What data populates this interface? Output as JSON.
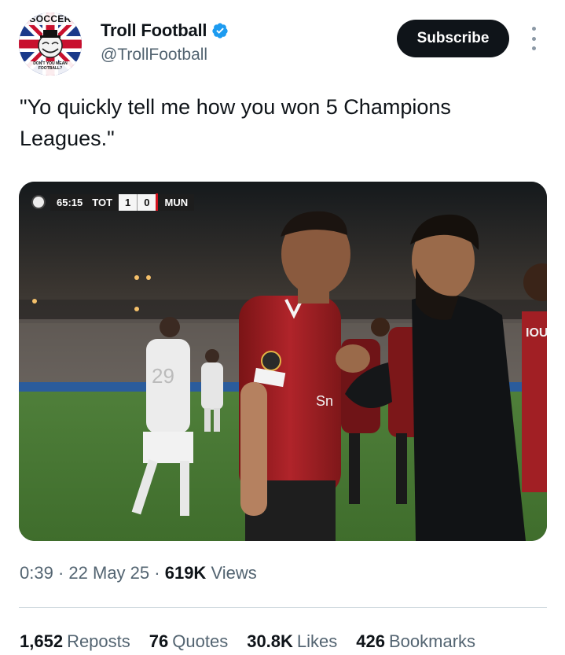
{
  "account": {
    "display_name": "Troll Football",
    "handle": "@TrollFootball",
    "avatar_top_text": "SOCCER",
    "avatar_bottom_text": "DON'T YOU MEAN FOOTBALL?",
    "verified_icon": "verified-badge-icon",
    "verified_color": "#1d9bf0"
  },
  "actions": {
    "subscribe_label": "Subscribe",
    "more_icon": "vertical-ellipsis-icon"
  },
  "tweet": {
    "text": "\"Yo quickly tell me how you won 5 Champions Leagues.\""
  },
  "media": {
    "scoreboard": {
      "time": "65:15",
      "home": "TOT",
      "home_score": "1",
      "away_score": "0",
      "away": "MUN"
    },
    "player_number": "29",
    "jersey_sponsor": "Sn",
    "sleeve_text": "IOU"
  },
  "meta": {
    "time": "0:39",
    "separator": "·",
    "date": "22 May 25",
    "views_count": "619K",
    "views_label": "Views"
  },
  "stats": [
    {
      "count": "1,652",
      "label": "Reposts"
    },
    {
      "count": "76",
      "label": "Quotes"
    },
    {
      "count": "30.8K",
      "label": "Likes"
    },
    {
      "count": "426",
      "label": "Bookmarks"
    }
  ]
}
